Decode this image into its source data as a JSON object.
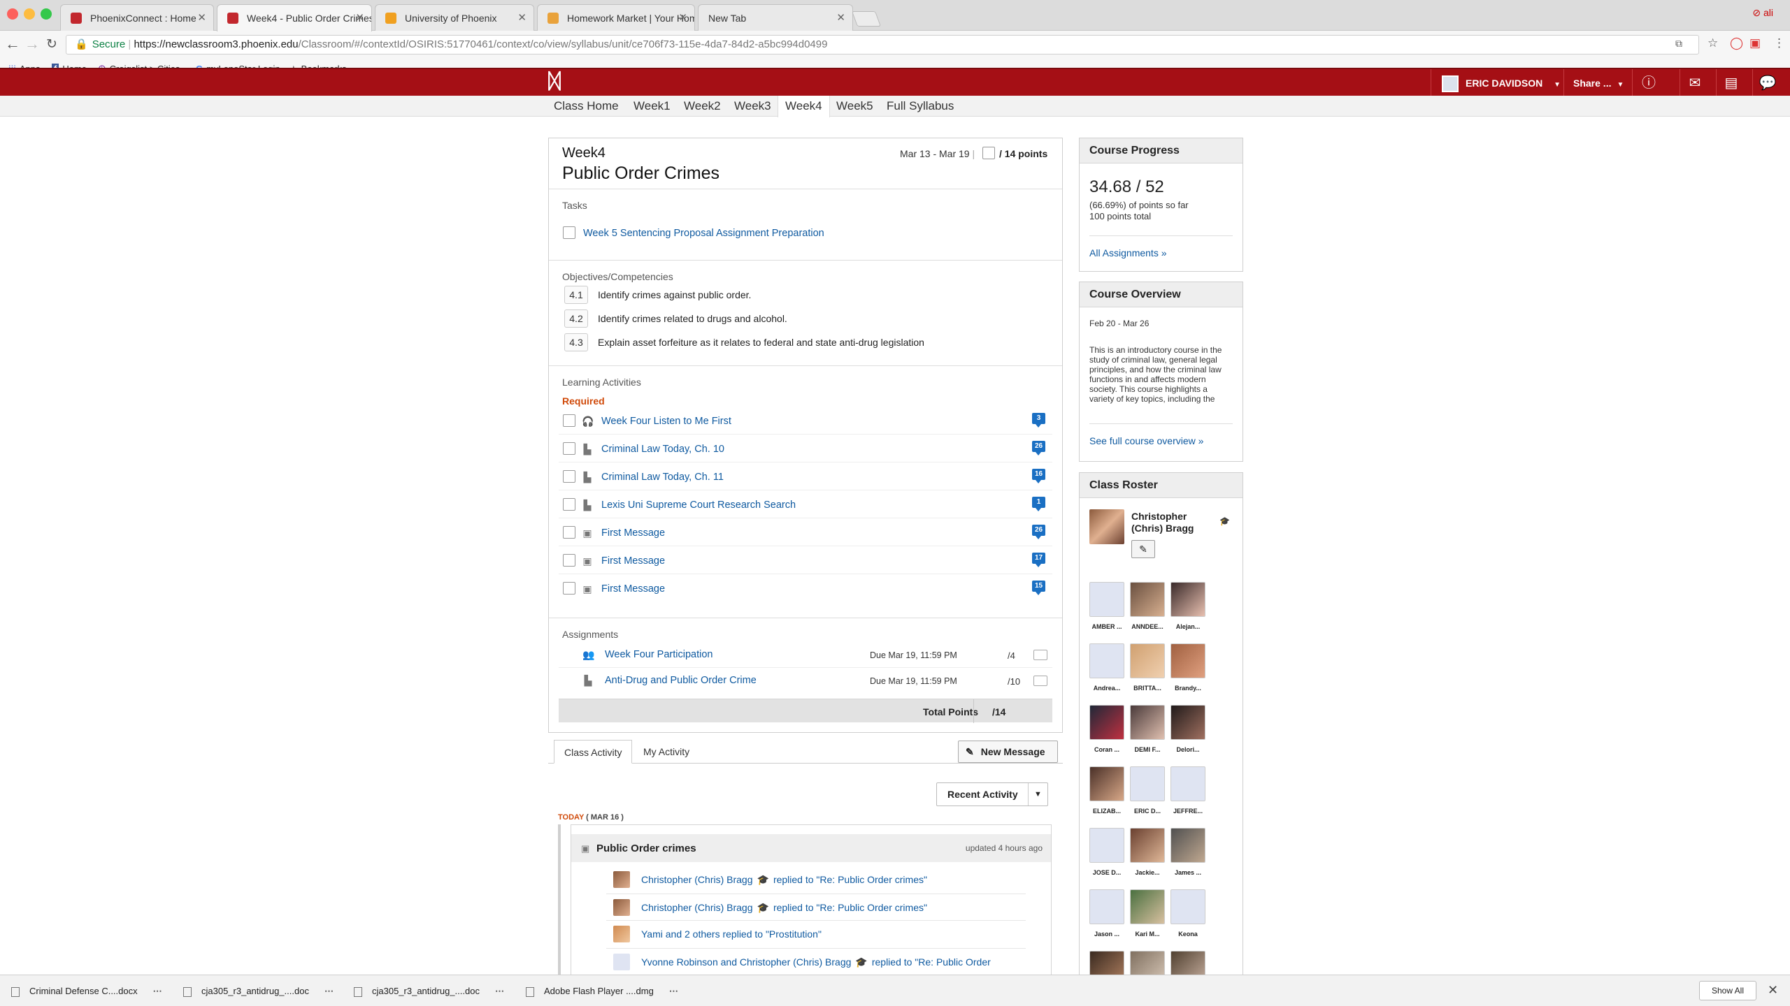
{
  "browser": {
    "tabs": [
      {
        "title": "PhoenixConnect : Home"
      },
      {
        "title": "Week4 - Public Order Crimes"
      },
      {
        "title": "University of Phoenix"
      },
      {
        "title": "Homework Market | Your Homework"
      },
      {
        "title": "New Tab"
      }
    ],
    "profile_label": "ali",
    "url_secure": "Secure",
    "url_host": "https://newclassroom3.phoenix.edu",
    "url_path": "/Classroom/#/contextId/OSIRIS:51770461/context/co/view/syllabus/unit/ce706f73-115e-4da7-84d2-a5bc994d0499",
    "bookmarks": [
      {
        "label": "Apps",
        "icon": "apps-grid-icon"
      },
      {
        "label": "Home",
        "icon": "facebook-icon"
      },
      {
        "label": "Craigslist > Cities",
        "icon": "peace-icon"
      },
      {
        "label": "myLoneStar Login",
        "icon": "google-icon"
      },
      {
        "label": "Bookmarks",
        "icon": "star-icon"
      }
    ]
  },
  "header": {
    "user_name": "ERIC DAVIDSON",
    "share_label": "Share ..."
  },
  "week_nav": [
    "Class Home",
    "Week1",
    "Week2",
    "Week3",
    "Week4",
    "Week5",
    "Full Syllabus"
  ],
  "unit": {
    "week": "Week4",
    "title": "Public Order Crimes",
    "dates": "Mar 13 - Mar 19",
    "points": "/ 14 points",
    "tasks_label": "Tasks",
    "tasks": [
      "Week 5 Sentencing Proposal Assignment Preparation"
    ],
    "objectives_label": "Objectives/Competencies",
    "objectives": [
      {
        "num": "4.1",
        "text": "Identify crimes against public order."
      },
      {
        "num": "4.2",
        "text": "Identify crimes related to drugs and alcohol."
      },
      {
        "num": "4.3",
        "text": "Explain asset forfeiture as it relates to federal and state anti-drug legislation"
      }
    ],
    "activities_label": "Learning Activities",
    "required_label": "Required",
    "activities": [
      {
        "label": "Week Four Listen to Me First",
        "icon": "headphones-icon",
        "count": "3"
      },
      {
        "label": "Criminal Law Today, Ch. 10",
        "icon": "document-icon",
        "count": "26"
      },
      {
        "label": "Criminal Law Today, Ch. 11",
        "icon": "document-icon",
        "count": "16"
      },
      {
        "label": "Lexis Uni Supreme Court Research Search",
        "icon": "document-icon",
        "count": "1"
      },
      {
        "label": "First Message",
        "icon": "discussion-icon",
        "count": "26"
      },
      {
        "label": "First Message",
        "icon": "discussion-icon",
        "count": "17"
      },
      {
        "label": "First Message",
        "icon": "discussion-icon",
        "count": "15"
      }
    ],
    "assignments_label": "Assignments",
    "assignments": [
      {
        "label": "Week Four Participation",
        "icon": "participation-icon",
        "due": "Due Mar 19, 11:59 PM",
        "points": "/4"
      },
      {
        "label": "Anti-Drug and Public Order Crime",
        "icon": "document-icon",
        "due": "Due Mar 19, 11:59 PM",
        "points": "/10"
      }
    ],
    "total_label": "Total Points",
    "total_value": "/14"
  },
  "activity": {
    "tabs": [
      "Class Activity",
      "My Activity"
    ],
    "new_message": "New Message",
    "filter": "Recent Activity",
    "today_label": "TODAY",
    "today_date": "( MAR 16 )",
    "thread_title": "Public Order crimes",
    "thread_updated": "updated 4 hours ago",
    "rows": [
      {
        "who": "Christopher (Chris) Bragg",
        "action": "replied to \"Re: Public Order crimes\"",
        "instructor": true
      },
      {
        "who": "Christopher (Chris) Bragg",
        "action": "replied to \"Re: Public Order crimes\"",
        "instructor": true
      },
      {
        "who": "Yami and 2 others replied to \"Prostitution\"",
        "action": "",
        "instructor": false
      },
      {
        "who": "Yvonne Robinson and Christopher (Chris) Bragg",
        "action": "replied to \"Re: Public Order",
        "instructor": true
      }
    ]
  },
  "course_progress": {
    "title": "Course Progress",
    "score": "34.68 / 52",
    "percent_line": "(66.69%) of points so far",
    "total_line": "100 points total",
    "link": "All Assignments »"
  },
  "course_overview": {
    "title": "Course Overview",
    "dates": "Feb 20 - Mar 26",
    "description": "This is an introductory course in the study of criminal law, general legal principles, and how the criminal law functions in and affects modern society. This course highlights a variety of key topics, including the",
    "link": "See full course overview »"
  },
  "roster": {
    "title": "Class Roster",
    "instructor": "Christopher (Chris) Bragg",
    "students": [
      "AMBER ...",
      "ANNDEE...",
      "Alejan...",
      "Andrea...",
      "BRITTA...",
      "Brandy...",
      "Coran ...",
      "DEMI F...",
      "Delori...",
      "ELIZAB...",
      "ERIC D...",
      "JEFFRE...",
      "JOSE D...",
      "Jackie...",
      "James ...",
      "Jason ...",
      "Kari M...",
      "Keona"
    ]
  },
  "downloads": {
    "items": [
      "Criminal Defense C....docx",
      "cja305_r3_antidrug_....doc",
      "cja305_r3_antidrug_....doc",
      "Adobe Flash Player ....dmg"
    ],
    "show_all": "Show All"
  },
  "colors": {
    "brand_red": "#a50f15",
    "link_blue": "#0f5aa0",
    "badge_blue": "#1a6fc3",
    "accent_orange": "#d04a0a"
  }
}
